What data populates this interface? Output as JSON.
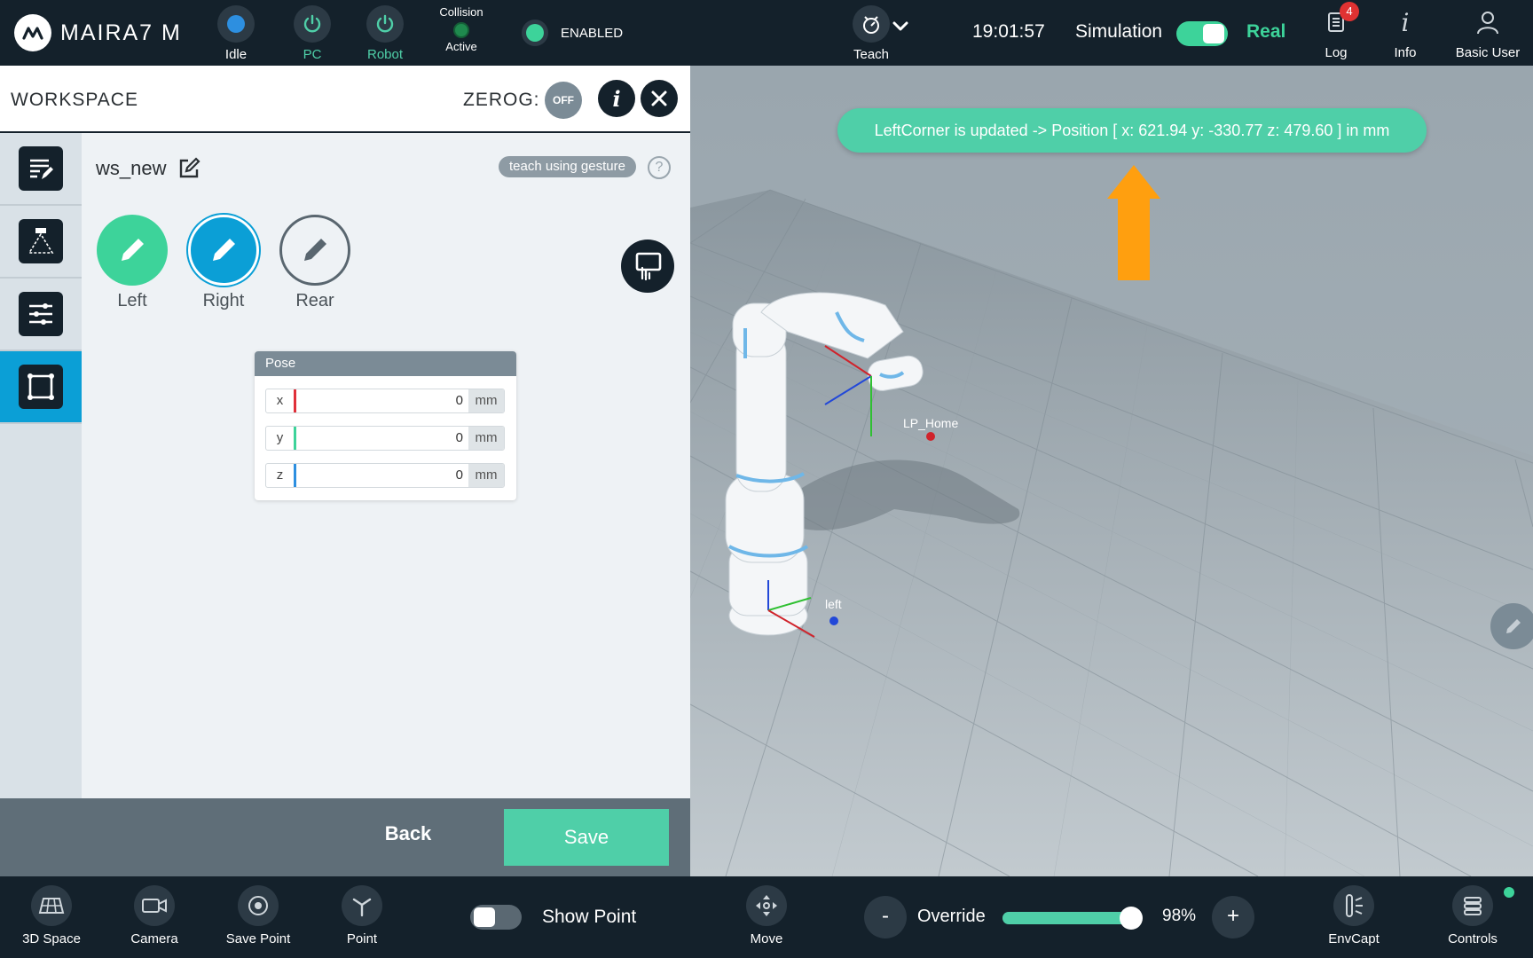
{
  "topbar": {
    "logo": "MAIRA7 M",
    "status": [
      {
        "label": "Idle"
      },
      {
        "label": "PC"
      },
      {
        "label": "Robot"
      }
    ],
    "collision": {
      "title": "Collision",
      "state": "Active"
    },
    "enabled": "ENABLED",
    "teach": "Teach",
    "clock": "19:01:57",
    "simulation": "Simulation",
    "real": "Real",
    "log": {
      "label": "Log",
      "badge": "4"
    },
    "info": "Info",
    "user": "Basic User"
  },
  "panel": {
    "title": "WORKSPACE",
    "zerog": "ZEROG:",
    "zerog_state": "OFF",
    "workspace_name": "ws_new",
    "gesture": "teach using gesture",
    "help": "?",
    "buttons": [
      {
        "label": "Left",
        "color": "#3dd39a"
      },
      {
        "label": "Right",
        "color": "#0b9fd6"
      },
      {
        "label": "Rear",
        "color": "#eef2f5"
      }
    ],
    "pose": {
      "title": "Pose",
      "rows": [
        {
          "axis": "x",
          "value": "0",
          "unit": "mm",
          "color": "#e0303a"
        },
        {
          "axis": "y",
          "value": "0",
          "unit": "mm",
          "color": "#3dd39a"
        },
        {
          "axis": "z",
          "value": "0",
          "unit": "mm",
          "color": "#2d8fe0"
        }
      ]
    },
    "back": "Back",
    "save": "Save"
  },
  "view": {
    "toast": "LeftCorner is updated -> Position [ x: 621.94 y: -330.77 z: 479.60 ] in mm",
    "labels": {
      "lp_home": "LP_Home",
      "left": "left"
    }
  },
  "bottombar": {
    "items": [
      {
        "label": "3D Space"
      },
      {
        "label": "Camera"
      },
      {
        "label": "Save Point"
      },
      {
        "label": "Point"
      }
    ],
    "show_point": "Show Point",
    "move": "Move",
    "override": {
      "minus": "-",
      "label": "Override",
      "value": "98%",
      "level": 0.98,
      "plus": "+"
    },
    "envcapt": "EnvCapt",
    "controls": "Controls"
  }
}
